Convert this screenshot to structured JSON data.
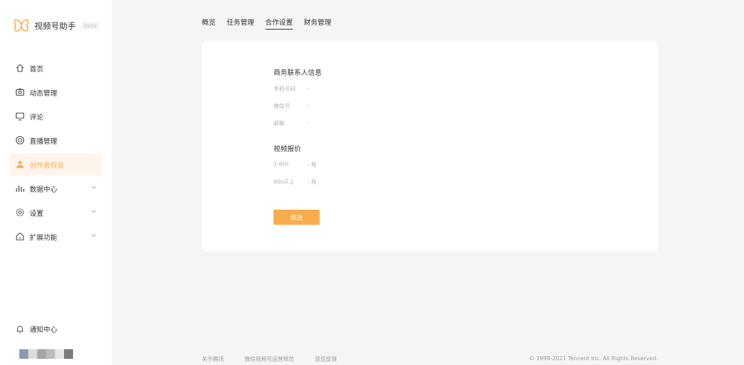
{
  "app": {
    "name": "视频号助手",
    "badge": "beta"
  },
  "sidebar": {
    "items": [
      {
        "label": "首页"
      },
      {
        "label": "动态管理"
      },
      {
        "label": "评论"
      },
      {
        "label": "直播管理"
      },
      {
        "label": "创作者权益"
      },
      {
        "label": "数据中心"
      },
      {
        "label": "设置"
      },
      {
        "label": "扩展功能"
      }
    ],
    "notification": "通知中心"
  },
  "tabs": [
    {
      "label": "概览"
    },
    {
      "label": "任务管理"
    },
    {
      "label": "合作设置",
      "active": true
    },
    {
      "label": "财务管理"
    }
  ],
  "card": {
    "contact_section": "商务联系人信息",
    "contact_rows": [
      {
        "label": "手机号码",
        "value": "-"
      },
      {
        "label": "微信号",
        "value": "-"
      },
      {
        "label": "邮箱",
        "value": "-"
      }
    ],
    "price_section": "视频报价",
    "price_rows": [
      {
        "label": "1-60s",
        "value": "- 元"
      },
      {
        "label": "60s以上",
        "value": "- 元"
      }
    ],
    "edit_button": "修改"
  },
  "footer": {
    "links": [
      "关于腾讯",
      "微信视频号运营规范",
      "意见反馈"
    ],
    "copyright": "© 1998-2021 Tencent Inc. All Rights Reserved."
  },
  "colors": {
    "accent": "#f7ad4c",
    "active_bg": "#fdf5ec",
    "page_bg": "#f5f5f5"
  }
}
